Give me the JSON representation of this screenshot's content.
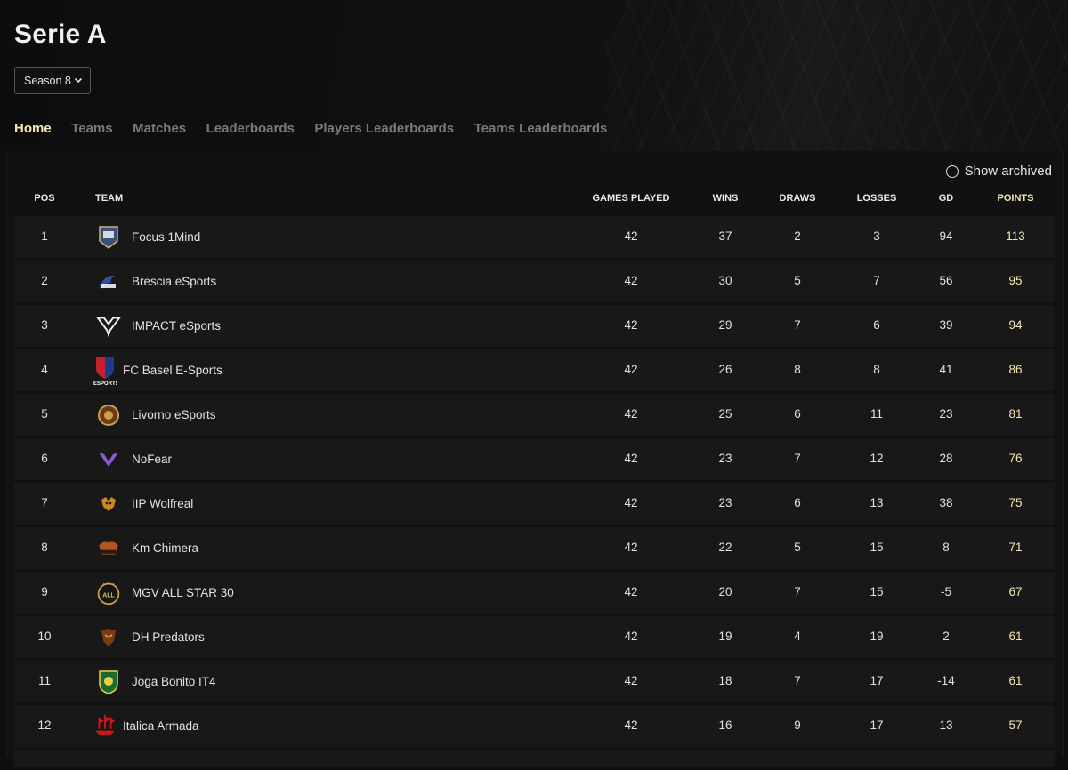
{
  "title": "Serie A",
  "season_select": {
    "value": "Season 8"
  },
  "nav": [
    "Home",
    "Teams",
    "Matches",
    "Leaderboards",
    "Players Leaderboards",
    "Teams Leaderboards"
  ],
  "show_archived": "Show archived",
  "columns": {
    "pos": "POS",
    "team": "TEAM",
    "games_played": "GAMES PLAYED",
    "wins": "WINS",
    "draws": "DRAWS",
    "losses": "LOSSES",
    "gd": "GD",
    "points": "POINTS"
  },
  "colors": {
    "accent": "#f3e7b0",
    "background": "#0f0f0f",
    "row": "#181818"
  },
  "standings": [
    {
      "pos": "1",
      "team": "Focus 1Mind",
      "logo": "focus-1mind-logo",
      "gp": "42",
      "w": "37",
      "d": "2",
      "l": "3",
      "gd": "94",
      "pts": "113"
    },
    {
      "pos": "2",
      "team": "Brescia eSports",
      "logo": "brescia-logo",
      "gp": "42",
      "w": "30",
      "d": "5",
      "l": "7",
      "gd": "56",
      "pts": "95"
    },
    {
      "pos": "3",
      "team": "IMPACT eSports",
      "logo": "impact-logo",
      "gp": "42",
      "w": "29",
      "d": "7",
      "l": "6",
      "gd": "39",
      "pts": "94"
    },
    {
      "pos": "4",
      "team": "FC Basel E-Sports",
      "logo": "fc-basel-logo",
      "gp": "42",
      "w": "26",
      "d": "8",
      "l": "8",
      "gd": "41",
      "pts": "86"
    },
    {
      "pos": "5",
      "team": "Livorno eSports",
      "logo": "livorno-logo",
      "gp": "42",
      "w": "25",
      "d": "6",
      "l": "11",
      "gd": "23",
      "pts": "81"
    },
    {
      "pos": "6",
      "team": "NoFear",
      "logo": "nofear-logo",
      "gp": "42",
      "w": "23",
      "d": "7",
      "l": "12",
      "gd": "28",
      "pts": "76"
    },
    {
      "pos": "7",
      "team": "IIP Wolfreal",
      "logo": "iip-wolfreal-logo",
      "gp": "42",
      "w": "23",
      "d": "6",
      "l": "13",
      "gd": "38",
      "pts": "75"
    },
    {
      "pos": "8",
      "team": "Km Chimera",
      "logo": "km-chimera-logo",
      "gp": "42",
      "w": "22",
      "d": "5",
      "l": "15",
      "gd": "8",
      "pts": "71"
    },
    {
      "pos": "9",
      "team": "MGV ALL STAR 30",
      "logo": "mgv-all-star-logo",
      "gp": "42",
      "w": "20",
      "d": "7",
      "l": "15",
      "gd": "-5",
      "pts": "67"
    },
    {
      "pos": "10",
      "team": "DH Predators",
      "logo": "dh-predators-logo",
      "gp": "42",
      "w": "19",
      "d": "4",
      "l": "19",
      "gd": "2",
      "pts": "61"
    },
    {
      "pos": "11",
      "team": "Joga Bonito IT4",
      "logo": "joga-bonito-logo",
      "gp": "42",
      "w": "18",
      "d": "7",
      "l": "17",
      "gd": "-14",
      "pts": "61"
    },
    {
      "pos": "12",
      "team": "Italica Armada",
      "logo": "italica-armada-logo",
      "gp": "42",
      "w": "16",
      "d": "9",
      "l": "17",
      "gd": "13",
      "pts": "57"
    }
  ]
}
